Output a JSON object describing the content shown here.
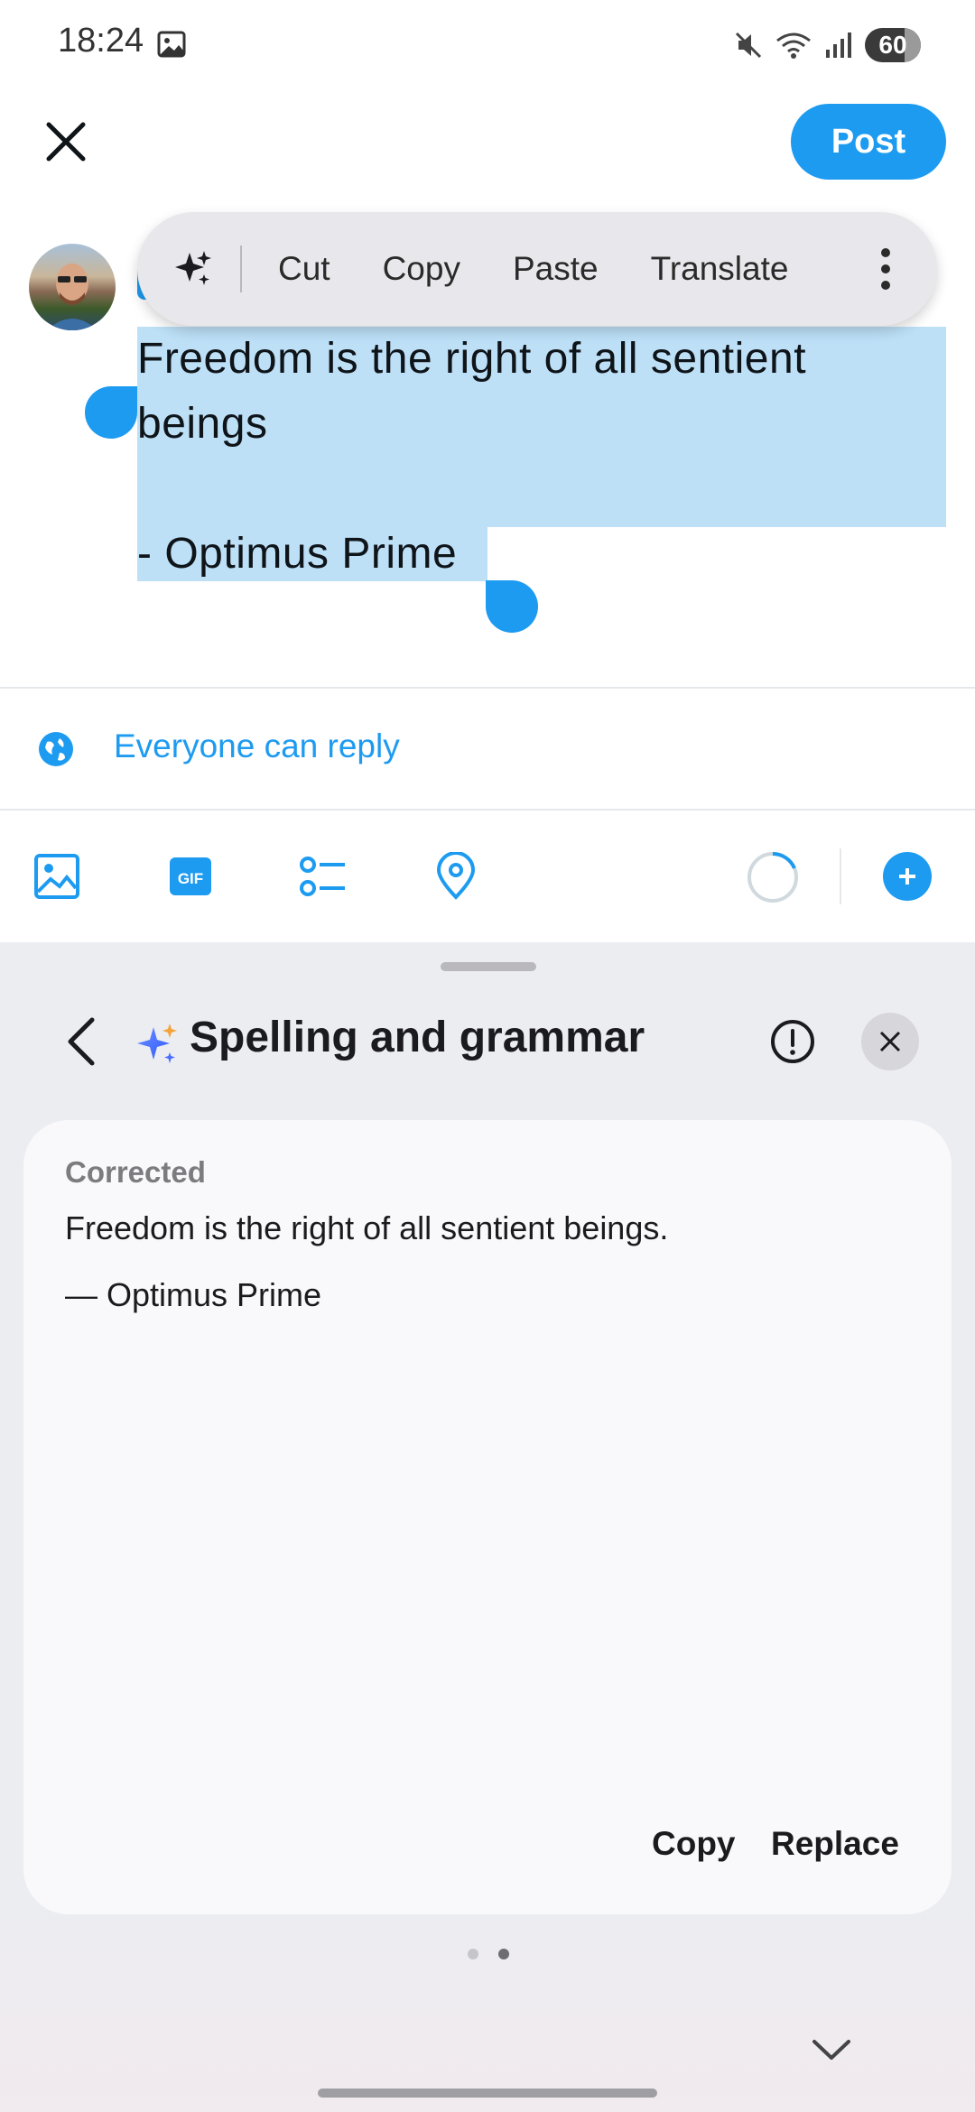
{
  "status_bar": {
    "time": "18:24",
    "icons": [
      "gallery-icon",
      "mute-icon",
      "wifi-icon",
      "signal-icon"
    ],
    "battery": "60"
  },
  "compose": {
    "post_label": "Post",
    "tweet_text": "Freedom is the right of all sentient\nbeings\n\n- Optimus Prime",
    "reply_setting": "Everyone can reply",
    "toolbar_icons": [
      "image-icon",
      "gif-icon",
      "poll-icon",
      "location-icon",
      "progress-ring-icon",
      "add-icon"
    ]
  },
  "context_menu": {
    "items": [
      "Cut",
      "Copy",
      "Paste",
      "Translate"
    ]
  },
  "sheet": {
    "title": "Spelling and grammar",
    "corrected_label": "Corrected",
    "corrected_lines": [
      "Freedom is the right of all sentient beings.",
      "— Optimus Prime"
    ],
    "copy_label": "Copy",
    "replace_label": "Replace",
    "page_count": 2,
    "current_page": 2
  },
  "colors": {
    "accent": "#1d9bf0",
    "selection": "#bde0f7",
    "sheet_bg": "#ecedf1",
    "card_bg": "#f9f9fb"
  }
}
